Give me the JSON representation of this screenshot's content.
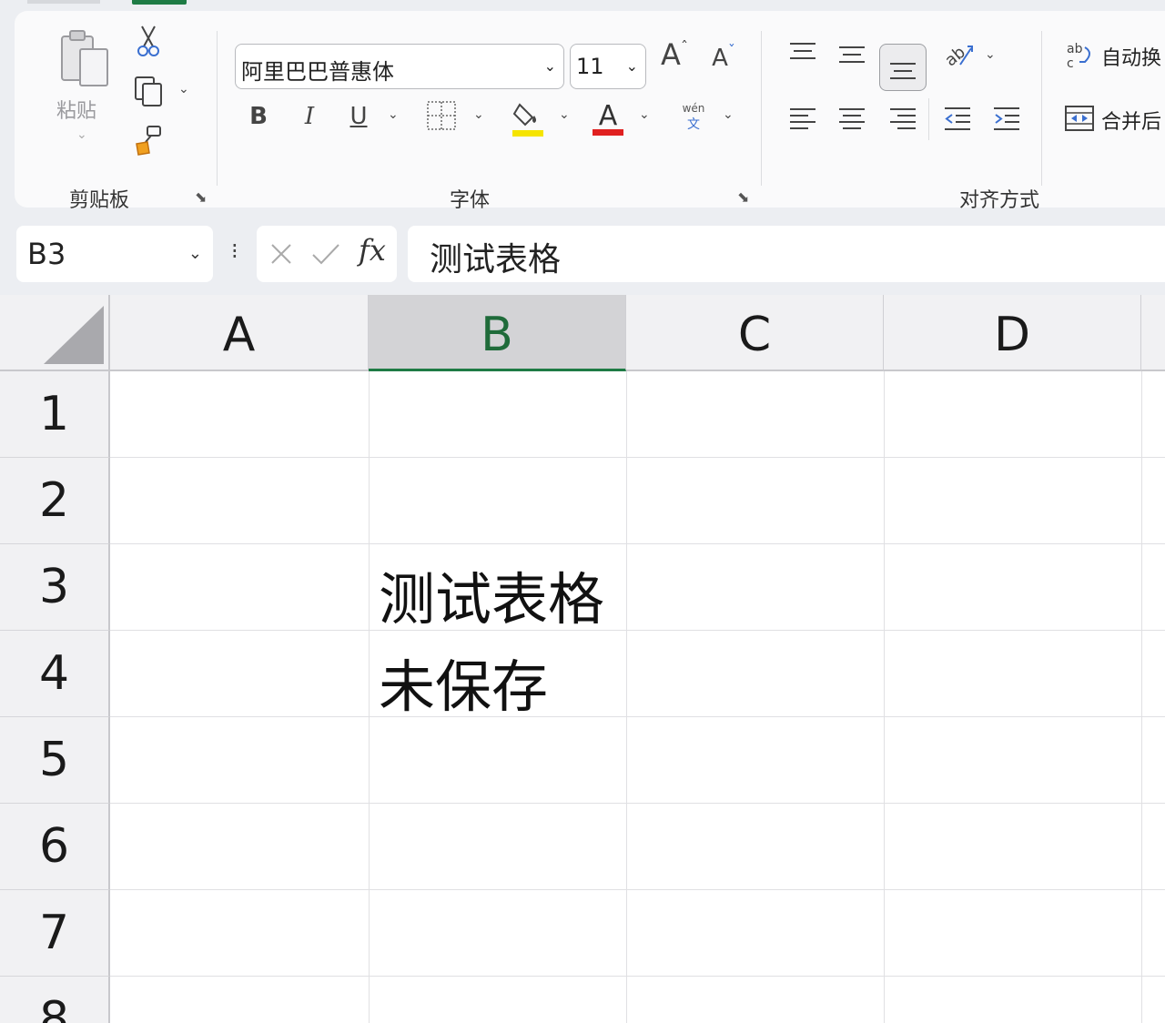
{
  "ribbon": {
    "clipboard": {
      "paste_label": "粘贴",
      "group_label": "剪贴板",
      "icons": [
        "paste-icon",
        "cut-icon",
        "copy-icon",
        "format-painter-icon"
      ]
    },
    "font": {
      "font_name": "阿里巴巴普惠体",
      "font_size": "11",
      "group_label": "字体",
      "fill_color": "#f5e400",
      "font_color": "#e02020"
    },
    "alignment": {
      "group_label": "对齐方式",
      "wrap_text_label": "自动换",
      "merge_label": "合并后"
    }
  },
  "formula_bar": {
    "name_box": "B3",
    "fx_label": "fx",
    "formula": "测试表格"
  },
  "sheet": {
    "columns": [
      "A",
      "B",
      "C",
      "D"
    ],
    "selected_column": "B",
    "rows": [
      "1",
      "2",
      "3",
      "4",
      "5",
      "6",
      "7",
      "8"
    ],
    "cells": {
      "B3": "测试表格",
      "B4": "未保存"
    }
  },
  "colors": {
    "accent": "#1e7b45",
    "selected_header_text": "#1f6b3a"
  }
}
